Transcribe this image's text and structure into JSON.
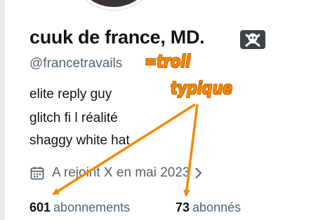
{
  "profile": {
    "display_name": "cuuk de france, MD.",
    "handle": "@francetravails",
    "bio": [
      "elite reply guy",
      "glitch fi l réalité",
      "shaggy white hat"
    ],
    "joined": "A rejoint X en mai 2023",
    "badge_icon": "skull-crossbones-icon"
  },
  "stats": {
    "following_count": "601",
    "following_label": "abonnements",
    "followers_count": "73",
    "followers_label": "abonnés"
  },
  "annotation": {
    "line1": "=troll",
    "line2": "typique",
    "color": "#f28a05"
  },
  "colors": {
    "text": "#0f1419",
    "secondary": "#536471"
  }
}
